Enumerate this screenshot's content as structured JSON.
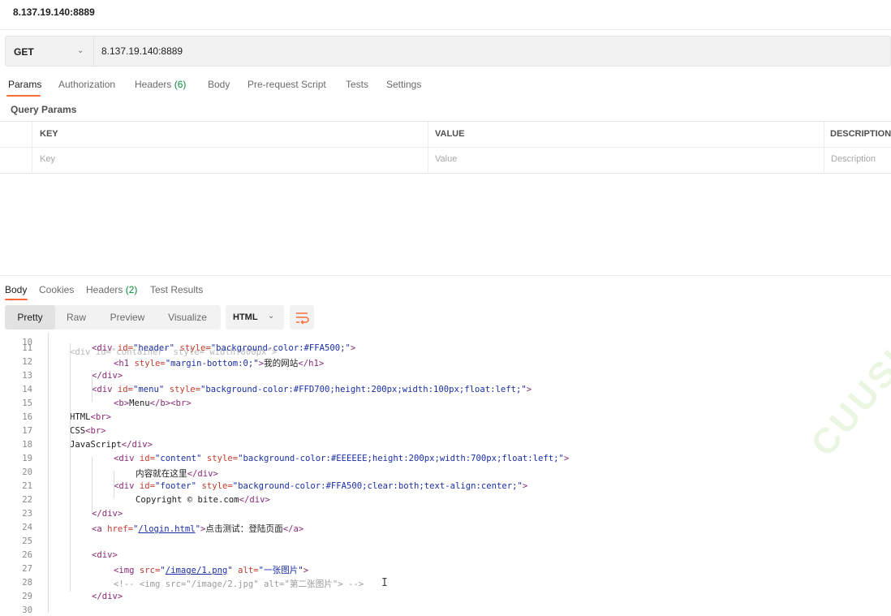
{
  "window": {
    "title": "8.137.19.140:8889"
  },
  "request": {
    "method": "GET",
    "url": "8.137.19.140:8889",
    "tabs": [
      {
        "label": "Params"
      },
      {
        "label": "Authorization"
      },
      {
        "label": "Headers",
        "count": "(6)"
      },
      {
        "label": "Body"
      },
      {
        "label": "Pre-request Script"
      },
      {
        "label": "Tests"
      },
      {
        "label": "Settings"
      }
    ],
    "query_params_label": "Query Params",
    "table": {
      "headers": [
        "KEY",
        "VALUE",
        "DESCRIPTION"
      ],
      "placeholders": [
        "Key",
        "Value",
        "Description"
      ]
    }
  },
  "response": {
    "tabs": [
      {
        "label": "Body"
      },
      {
        "label": "Cookies"
      },
      {
        "label": "Headers",
        "count": "(2)"
      },
      {
        "label": "Test Results"
      }
    ],
    "view_modes": [
      "Pretty",
      "Raw",
      "Preview",
      "Visualize"
    ],
    "format": "HTML",
    "code": {
      "first_line_partial": "<div id=\"container\" style=\"width:800px\">",
      "lines": [
        [
          11,
          [
            [
              "tag",
              "<div "
            ],
            [
              "attr",
              "id="
            ],
            [
              "str",
              "\"header\""
            ],
            [
              "attr",
              " style="
            ],
            [
              "str",
              "\"background-color:#FFA500;\""
            ],
            [
              "tag",
              ">"
            ]
          ]
        ],
        [
          12,
          [
            [
              "tag",
              "<h1 "
            ],
            [
              "attr",
              "style="
            ],
            [
              "str",
              "\"margin-bottom:0;\""
            ],
            [
              "tag",
              ">"
            ],
            [
              "txt",
              "我的网站"
            ],
            [
              "tag",
              "</h1>"
            ]
          ]
        ],
        [
          13,
          [
            [
              "tag",
              "</div>"
            ]
          ]
        ],
        [
          14,
          [
            [
              "tag",
              "<div "
            ],
            [
              "attr",
              "id="
            ],
            [
              "str",
              "\"menu\""
            ],
            [
              "attr",
              " style="
            ],
            [
              "str",
              "\"background-color:#FFD700;height:200px;width:100px;float:left;\""
            ],
            [
              "tag",
              ">"
            ]
          ]
        ],
        [
          15,
          [
            [
              "tag",
              "<b>"
            ],
            [
              "txt",
              "Menu"
            ],
            [
              "tag",
              "</b><br>"
            ]
          ]
        ],
        [
          16,
          [
            [
              "txt",
              "HTML"
            ],
            [
              "tag",
              "<br>"
            ]
          ]
        ],
        [
          17,
          [
            [
              "txt",
              "CSS"
            ],
            [
              "tag",
              "<br>"
            ]
          ]
        ],
        [
          18,
          [
            [
              "txt",
              "JavaScript"
            ],
            [
              "tag",
              "</div>"
            ]
          ]
        ],
        [
          19,
          [
            [
              "tag",
              "<div "
            ],
            [
              "attr",
              "id="
            ],
            [
              "str",
              "\"content\""
            ],
            [
              "attr",
              " style="
            ],
            [
              "str",
              "\"background-color:#EEEEEE;height:200px;width:700px;float:left;\""
            ],
            [
              "tag",
              ">"
            ]
          ]
        ],
        [
          20,
          [
            [
              "txt",
              "内容就在这里"
            ],
            [
              "tag",
              "</div>"
            ]
          ]
        ],
        [
          21,
          [
            [
              "tag",
              "<div "
            ],
            [
              "attr",
              "id="
            ],
            [
              "str",
              "\"footer\""
            ],
            [
              "attr",
              " style="
            ],
            [
              "str",
              "\"background-color:#FFA500;clear:both;text-align:center;\""
            ],
            [
              "tag",
              ">"
            ]
          ]
        ],
        [
          22,
          [
            [
              "txt",
              "Copyright © bite.com"
            ],
            [
              "tag",
              "</div>"
            ]
          ]
        ],
        [
          23,
          [
            [
              "tag",
              "</div>"
            ]
          ]
        ],
        [
          24,
          [
            [
              "tag",
              "<a "
            ],
            [
              "attr",
              "href="
            ],
            [
              "str",
              "\""
            ],
            [
              "link",
              "/login.html"
            ],
            [
              "str",
              "\""
            ],
            [
              "tag",
              ">"
            ],
            [
              "txt",
              "点击测试：登陆页面"
            ],
            [
              "tag",
              "</a>"
            ]
          ]
        ],
        [
          25,
          []
        ],
        [
          26,
          [
            [
              "tag",
              "<div>"
            ]
          ]
        ],
        [
          27,
          [
            [
              "tag",
              "<img "
            ],
            [
              "attr",
              "src="
            ],
            [
              "str",
              "\""
            ],
            [
              "link",
              "/image/1.png"
            ],
            [
              "str",
              "\""
            ],
            [
              "attr",
              " alt="
            ],
            [
              "str",
              "\"一张图片\""
            ],
            [
              "tag",
              ">"
            ]
          ]
        ],
        [
          28,
          [
            [
              "cmt",
              "<!-- <img src=\"/image/2.jpg\" alt=\"第二张图片\"> -->"
            ]
          ]
        ],
        [
          29,
          [
            [
              "tag",
              "</div>"
            ]
          ]
        ],
        [
          30,
          []
        ]
      ]
    }
  },
  "watermark_text": "CUUSIC",
  "colors": {
    "accent": "#ff6c37",
    "count_green": "#0a8a3a",
    "tag": "#8a2a76",
    "attr": "#c03d2f",
    "string": "#1a2ea6"
  },
  "icons": [
    "chevron-down-icon",
    "wrap-lines-icon",
    "text-cursor-icon"
  ]
}
